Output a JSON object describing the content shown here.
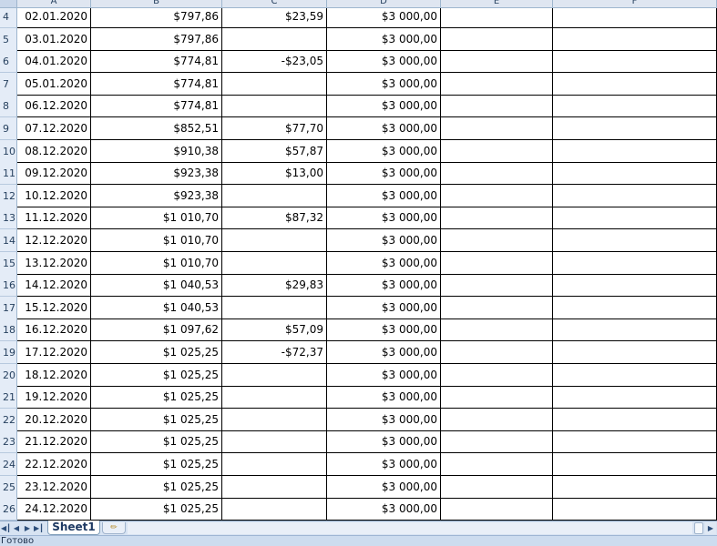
{
  "columns": [
    "A",
    "B",
    "C",
    "D",
    "E",
    "F"
  ],
  "rows": [
    {
      "num": "4",
      "date": "02.01.2020",
      "b": "$797,86",
      "c": "$23,59",
      "d": "$3 000,00"
    },
    {
      "num": "5",
      "date": "03.01.2020",
      "b": "$797,86",
      "c": "",
      "d": "$3 000,00"
    },
    {
      "num": "6",
      "date": "04.01.2020",
      "b": "$774,81",
      "c": "-$23,05",
      "d": "$3 000,00"
    },
    {
      "num": "7",
      "date": "05.01.2020",
      "b": "$774,81",
      "c": "",
      "d": "$3 000,00"
    },
    {
      "num": "8",
      "date": "06.12.2020",
      "b": "$774,81",
      "c": "",
      "d": "$3 000,00"
    },
    {
      "num": "9",
      "date": "07.12.2020",
      "b": "$852,51",
      "c": "$77,70",
      "d": "$3 000,00"
    },
    {
      "num": "10",
      "date": "08.12.2020",
      "b": "$910,38",
      "c": "$57,87",
      "d": "$3 000,00"
    },
    {
      "num": "11",
      "date": "09.12.2020",
      "b": "$923,38",
      "c": "$13,00",
      "d": "$3 000,00"
    },
    {
      "num": "12",
      "date": "10.12.2020",
      "b": "$923,38",
      "c": "",
      "d": "$3 000,00"
    },
    {
      "num": "13",
      "date": "11.12.2020",
      "b": "$1 010,70",
      "c": "$87,32",
      "d": "$3 000,00"
    },
    {
      "num": "14",
      "date": "12.12.2020",
      "b": "$1 010,70",
      "c": "",
      "d": "$3 000,00"
    },
    {
      "num": "15",
      "date": "13.12.2020",
      "b": "$1 010,70",
      "c": "",
      "d": "$3 000,00"
    },
    {
      "num": "16",
      "date": "14.12.2020",
      "b": "$1 040,53",
      "c": "$29,83",
      "d": "$3 000,00"
    },
    {
      "num": "17",
      "date": "15.12.2020",
      "b": "$1 040,53",
      "c": "",
      "d": "$3 000,00"
    },
    {
      "num": "18",
      "date": "16.12.2020",
      "b": "$1 097,62",
      "c": "$57,09",
      "d": "$3 000,00"
    },
    {
      "num": "19",
      "date": "17.12.2020",
      "b": "$1 025,25",
      "c": "-$72,37",
      "d": "$3 000,00"
    },
    {
      "num": "20",
      "date": "18.12.2020",
      "b": "$1 025,25",
      "c": "",
      "d": "$3 000,00"
    },
    {
      "num": "21",
      "date": "19.12.2020",
      "b": "$1 025,25",
      "c": "",
      "d": "$3 000,00"
    },
    {
      "num": "22",
      "date": "20.12.2020",
      "b": "$1 025,25",
      "c": "",
      "d": "$3 000,00"
    },
    {
      "num": "23",
      "date": "21.12.2020",
      "b": "$1 025,25",
      "c": "",
      "d": "$3 000,00"
    },
    {
      "num": "24",
      "date": "22.12.2020",
      "b": "$1 025,25",
      "c": "",
      "d": "$3 000,00"
    },
    {
      "num": "25",
      "date": "23.12.2020",
      "b": "$1 025,25",
      "c": "",
      "d": "$3 000,00"
    },
    {
      "num": "26",
      "date": "24.12.2020",
      "b": "$1 025,25",
      "c": "",
      "d": "$3 000,00"
    }
  ],
  "sheet_tab": {
    "label": "Sheet1"
  },
  "status": {
    "text": "Готово"
  },
  "icons": {
    "nav_first": "first-sheet-icon",
    "nav_prev": "prev-sheet-icon",
    "nav_next": "next-sheet-icon",
    "nav_last": "last-sheet-icon",
    "new_sheet": "insert-sheet-icon"
  },
  "colors": {
    "header_bg": "#dfe6f1",
    "tab_text": "#1f3a63",
    "status_bg": "#cddcef"
  }
}
